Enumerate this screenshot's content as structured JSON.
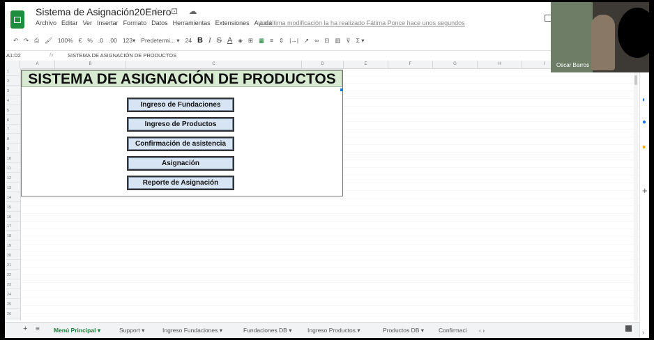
{
  "header": {
    "title": "Sistema de Asignación20Enero",
    "title_icons": "☆ ⊡ ☁",
    "menu": [
      "Archivo",
      "Editar",
      "Ver",
      "Insertar",
      "Formato",
      "Datos",
      "Herramientas",
      "Extensiones",
      "Ayuda"
    ],
    "last_edit": "La última modificación la ha realizado Fátima Ponce hace unos segundos"
  },
  "toolbar": {
    "zoom": "100%",
    "currency": "€",
    "percent": "%",
    "decimals_dec": ".0",
    ".00": ".00",
    "format_123": "123▾",
    "font": "Predetermi... ▾",
    "font_size": "24",
    "bold": "B",
    "italic": "I",
    "strike": "S",
    "text_color": "A",
    "sum": "Σ ▾"
  },
  "formula_bar": {
    "cell_ref": "A1:D2",
    "fx": "fx",
    "content": "SISTEMA DE ASIGNACIÓN DE PRODUCTOS"
  },
  "columns": [
    "A",
    "B",
    "C",
    "D",
    "E",
    "F",
    "G",
    "H",
    "I"
  ],
  "rows": [
    "1",
    "2",
    "3",
    "4",
    "5",
    "6",
    "7",
    "8",
    "9",
    "10",
    "11",
    "12",
    "13",
    "14",
    "15",
    "16",
    "17",
    "18",
    "19",
    "20",
    "21",
    "22",
    "23",
    "24",
    "25",
    "26"
  ],
  "sheet": {
    "banner": "SISTEMA DE ASIGNACIÓN DE PRODUCTOS",
    "buttons": [
      "Ingreso de Fundaciones",
      "Ingreso de Productos",
      "Confirmación de asistencia",
      "Asignación",
      "Reporte de Asignación"
    ]
  },
  "video": {
    "participant_name": "Oscar Barros"
  },
  "tabs": {
    "add": "+",
    "list_icon": "≡",
    "items": [
      "Menú Principal ▾",
      "Support ▾",
      "Ingreso Fundaciones ▾",
      "Fundaciones DB ▾",
      "Ingreso Productos ▾",
      "Productos DB ▾",
      "Confirmaci"
    ],
    "nav": "‹ ›"
  },
  "colors": {
    "banner_bg": "#d9ead3",
    "button_bg": "#d7e4f4",
    "sheets_green": "#1e8e3e"
  }
}
